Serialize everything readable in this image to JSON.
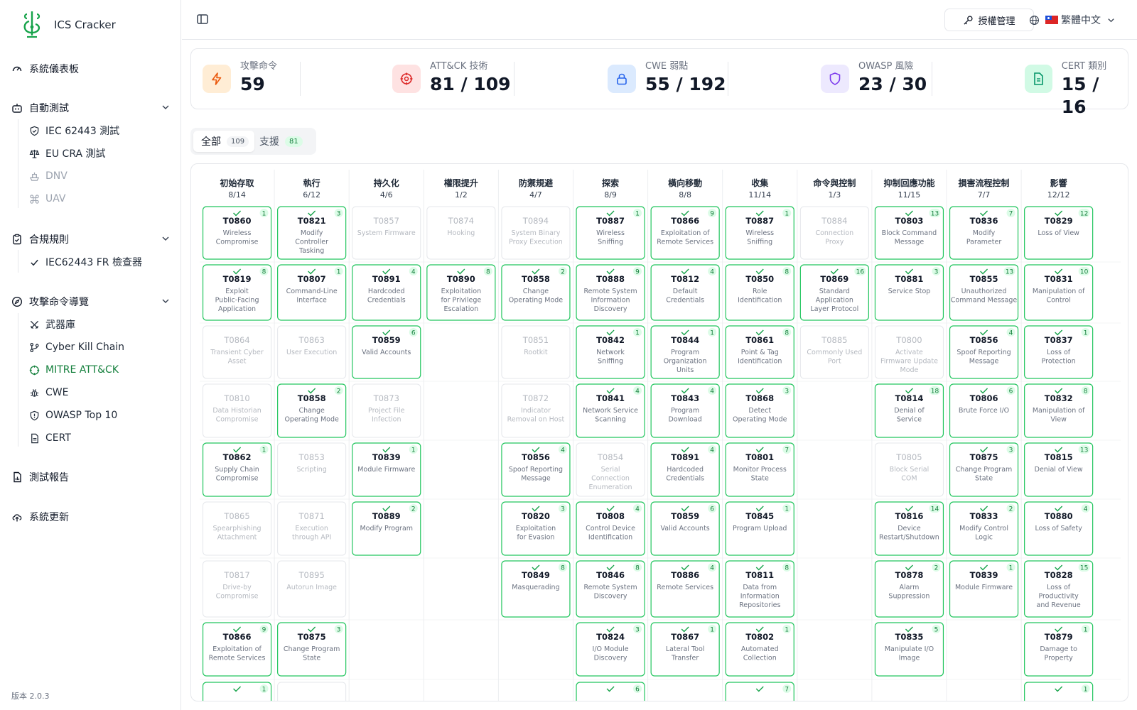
{
  "app": {
    "name": "ICS Cracker",
    "version": "版本 2.0.3"
  },
  "sidebar": {
    "dashboard": "系統儀表板",
    "auto_test": {
      "label": "自動測試",
      "items": [
        "IEC 62443 測試",
        "EU CRA 測試",
        "DNV",
        "UAV"
      ]
    },
    "compliance": {
      "label": "合規規則",
      "items": [
        "IEC62443 FR 檢查器"
      ]
    },
    "attack_nav": {
      "label": "攻擊命令導覽",
      "items": [
        "武器庫",
        "Cyber Kill Chain",
        "MITRE ATT&CK",
        "CWE",
        "OWASP Top 10",
        "CERT"
      ]
    },
    "reports": "測試報告",
    "update": "系統更新"
  },
  "header": {
    "license_label": "授權管理",
    "language": "繁體中文"
  },
  "stats": [
    {
      "label": "攻擊命令",
      "value": "59",
      "color": "#ea580c",
      "bg": "#ffedd5",
      "icon": "lightning-icon"
    },
    {
      "label": "ATT&CK 技術",
      "value": "81 / 109",
      "color": "#dc2626",
      "bg": "#fee2e2",
      "icon": "target-icon"
    },
    {
      "label": "CWE 弱點",
      "value": "55 / 192",
      "color": "#2563eb",
      "bg": "#dbeafe",
      "icon": "lock-icon"
    },
    {
      "label": "OWASP 風險",
      "value": "23 / 30",
      "color": "#7c3aed",
      "bg": "#ede9fe",
      "icon": "shield-icon"
    },
    {
      "label": "CERT 類別",
      "value": "15 / 16",
      "color": "#059669",
      "bg": "#d1fae5",
      "icon": "document-icon"
    }
  ],
  "tabs": [
    {
      "label": "全部",
      "count": "109"
    },
    {
      "label": "支援",
      "count": "81"
    }
  ],
  "matrix": {
    "colors": {
      "active_border": "#22c55e",
      "inactive_border": "#e5e7eb",
      "check": "#16a34a",
      "badge_bg": "#dcfce7",
      "badge_text": "#15803d",
      "muted_text": "#b5b9c0",
      "sub_text": "#6b7280"
    },
    "columns": [
      {
        "name": "初始存取",
        "count": "8/14",
        "cells": [
          {
            "id": "T0860",
            "name": "Wireless Compromise",
            "n": "1"
          },
          {
            "id": "T0819",
            "name": "Exploit Public-Facing Application",
            "n": "8"
          },
          {
            "id": "T0864",
            "name": "Transient Cyber Asset",
            "n": ""
          },
          {
            "id": "T0810",
            "name": "Data Historian Compromise",
            "n": ""
          },
          {
            "id": "T0862",
            "name": "Supply Chain Compromise",
            "n": "1"
          },
          {
            "id": "T0865",
            "name": "Spearphishing Attachment",
            "n": ""
          },
          {
            "id": "T0817",
            "name": "Drive-by Compromise",
            "n": ""
          },
          {
            "id": "T0866",
            "name": "Exploitation of Remote Services",
            "n": "9"
          },
          {
            "id": "",
            "name": "",
            "n": "1"
          }
        ]
      },
      {
        "name": "執行",
        "count": "6/12",
        "cells": [
          {
            "id": "T0821",
            "name": "Modify Controller Tasking",
            "n": "3"
          },
          {
            "id": "T0807",
            "name": "Command-Line Interface",
            "n": "1"
          },
          {
            "id": "T0863",
            "name": "User Execution",
            "n": ""
          },
          {
            "id": "T0858",
            "name": "Change Operating Mode",
            "n": "2"
          },
          {
            "id": "T0853",
            "name": "Scripting",
            "n": ""
          },
          {
            "id": "T0871",
            "name": "Execution through API",
            "n": ""
          },
          {
            "id": "T0895",
            "name": "Autorun Image",
            "n": ""
          },
          {
            "id": "T0875",
            "name": "Change Program State",
            "n": "3"
          },
          {
            "id": "",
            "name": "",
            "n": ""
          }
        ]
      },
      {
        "name": "持久化",
        "count": "4/6",
        "cells": [
          {
            "id": "T0857",
            "name": "System Firmware",
            "n": ""
          },
          {
            "id": "T0891",
            "name": "Hardcoded Credentials",
            "n": "4"
          },
          {
            "id": "T0859",
            "name": "Valid Accounts",
            "n": "6"
          },
          {
            "id": "T0873",
            "name": "Project File Infection",
            "n": ""
          },
          {
            "id": "T0839",
            "name": "Module Firmware",
            "n": "1"
          },
          {
            "id": "T0889",
            "name": "Modify Program",
            "n": "2"
          }
        ]
      },
      {
        "name": "權限提升",
        "count": "1/2",
        "cells": [
          {
            "id": "T0874",
            "name": "Hooking",
            "n": ""
          },
          {
            "id": "T0890",
            "name": "Exploitation for Privilege Escalation",
            "n": "8"
          }
        ]
      },
      {
        "name": "防禦規避",
        "count": "4/7",
        "cells": [
          {
            "id": "T0894",
            "name": "System Binary Proxy Execution",
            "n": ""
          },
          {
            "id": "T0858",
            "name": "Change Operating Mode",
            "n": "2"
          },
          {
            "id": "T0851",
            "name": "Rootkit",
            "n": ""
          },
          {
            "id": "T0872",
            "name": "Indicator Removal on Host",
            "n": ""
          },
          {
            "id": "T0856",
            "name": "Spoof Reporting Message",
            "n": "4"
          },
          {
            "id": "T0820",
            "name": "Exploitation for Evasion",
            "n": "3"
          },
          {
            "id": "T0849",
            "name": "Masquerading",
            "n": "8"
          }
        ]
      },
      {
        "name": "探索",
        "count": "8/9",
        "cells": [
          {
            "id": "T0887",
            "name": "Wireless Sniffing",
            "n": "1"
          },
          {
            "id": "T0888",
            "name": "Remote System Information Discovery",
            "n": "9"
          },
          {
            "id": "T0842",
            "name": "Network Sniffing",
            "n": "1"
          },
          {
            "id": "T0841",
            "name": "Network Service Scanning",
            "n": "4"
          },
          {
            "id": "T0854",
            "name": "Serial Connection Enumeration",
            "n": ""
          },
          {
            "id": "T0808",
            "name": "Control Device Identification",
            "n": "4"
          },
          {
            "id": "T0846",
            "name": "Remote System Discovery",
            "n": "8"
          },
          {
            "id": "T0824",
            "name": "I/O Module Discovery",
            "n": "3"
          },
          {
            "id": "",
            "name": "",
            "n": "6"
          }
        ]
      },
      {
        "name": "橫向移動",
        "count": "8/8",
        "cells": [
          {
            "id": "T0866",
            "name": "Exploitation of Remote Services",
            "n": "9"
          },
          {
            "id": "T0812",
            "name": "Default Credentials",
            "n": "4"
          },
          {
            "id": "T0844",
            "name": "Program Organization Units",
            "n": "1"
          },
          {
            "id": "T0843",
            "name": "Program Download",
            "n": "4"
          },
          {
            "id": "T0891",
            "name": "Hardcoded Credentials",
            "n": "4"
          },
          {
            "id": "T0859",
            "name": "Valid Accounts",
            "n": "6"
          },
          {
            "id": "T0886",
            "name": "Remote Services",
            "n": "4"
          },
          {
            "id": "T0867",
            "name": "Lateral Tool Transfer",
            "n": "1"
          }
        ]
      },
      {
        "name": "收集",
        "count": "11/14",
        "cells": [
          {
            "id": "T0887",
            "name": "Wireless Sniffing",
            "n": "1"
          },
          {
            "id": "T0850",
            "name": "Role Identification",
            "n": "8"
          },
          {
            "id": "T0861",
            "name": "Point & Tag Identification",
            "n": "8"
          },
          {
            "id": "T0868",
            "name": "Detect Operating Mode",
            "n": "3"
          },
          {
            "id": "T0801",
            "name": "Monitor Process State",
            "n": "7"
          },
          {
            "id": "T0845",
            "name": "Program Upload",
            "n": "1"
          },
          {
            "id": "T0811",
            "name": "Data from Information Repositories",
            "n": "8"
          },
          {
            "id": "T0802",
            "name": "Automated Collection",
            "n": "1"
          },
          {
            "id": "",
            "name": "",
            "n": "7"
          }
        ]
      },
      {
        "name": "命令與控制",
        "count": "1/3",
        "cells": [
          {
            "id": "T0884",
            "name": "Connection Proxy",
            "n": ""
          },
          {
            "id": "T0869",
            "name": "Standard Application Layer Protocol",
            "n": "16"
          },
          {
            "id": "T0885",
            "name": "Commonly Used Port",
            "n": ""
          }
        ]
      },
      {
        "name": "抑制回應功能",
        "count": "11/15",
        "cells": [
          {
            "id": "T0803",
            "name": "Block Command Message",
            "n": "13"
          },
          {
            "id": "T0881",
            "name": "Service Stop",
            "n": "3"
          },
          {
            "id": "T0800",
            "name": "Activate Firmware Update Mode",
            "n": ""
          },
          {
            "id": "T0814",
            "name": "Denial of Service",
            "n": "18"
          },
          {
            "id": "T0805",
            "name": "Block Serial COM",
            "n": ""
          },
          {
            "id": "T0816",
            "name": "Device Restart/Shutdown",
            "n": "14"
          },
          {
            "id": "T0878",
            "name": "Alarm Suppression",
            "n": "2"
          },
          {
            "id": "T0835",
            "name": "Manipulate I/O Image",
            "n": "5"
          }
        ]
      },
      {
        "name": "損害流程控制",
        "count": "7/7",
        "cells": [
          {
            "id": "T0836",
            "name": "Modify Parameter",
            "n": "7"
          },
          {
            "id": "T0855",
            "name": "Unauthorized Command Message",
            "n": "13"
          },
          {
            "id": "T0856",
            "name": "Spoof Reporting Message",
            "n": "4"
          },
          {
            "id": "T0806",
            "name": "Brute Force I/O",
            "n": "6"
          },
          {
            "id": "T0875",
            "name": "Change Program State",
            "n": "3"
          },
          {
            "id": "T0833",
            "name": "Modify Control Logic",
            "n": "2"
          },
          {
            "id": "T0839",
            "name": "Module Firmware",
            "n": "1"
          }
        ]
      },
      {
        "name": "影響",
        "count": "12/12",
        "cells": [
          {
            "id": "T0829",
            "name": "Loss of View",
            "n": "12"
          },
          {
            "id": "T0831",
            "name": "Manipulation of Control",
            "n": "10"
          },
          {
            "id": "T0837",
            "name": "Loss of Protection",
            "n": "1"
          },
          {
            "id": "T0832",
            "name": "Manipulation of View",
            "n": "8"
          },
          {
            "id": "T0815",
            "name": "Denial of View",
            "n": "13"
          },
          {
            "id": "T0880",
            "name": "Loss of Safety",
            "n": "4"
          },
          {
            "id": "T0828",
            "name": "Loss of Productivity and Revenue",
            "n": "15"
          },
          {
            "id": "T0879",
            "name": "Damage to Property",
            "n": "1"
          },
          {
            "id": "",
            "name": "",
            "n": "1"
          }
        ]
      }
    ]
  }
}
